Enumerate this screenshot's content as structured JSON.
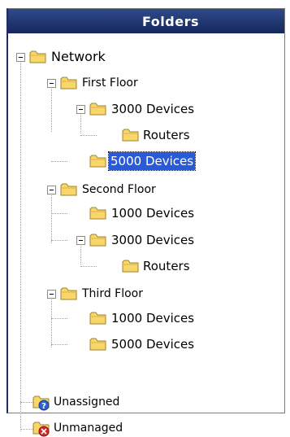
{
  "panel": {
    "title": "Folders"
  },
  "tree": {
    "root": "Network",
    "first_floor": "First Floor",
    "ff_3000": "3000 Devices",
    "ff_3000_routers": "Routers",
    "ff_5000": "5000 Devices",
    "second_floor": "Second Floor",
    "sf_1000": "1000 Devices",
    "sf_3000": "3000 Devices",
    "sf_3000_routers": "Routers",
    "third_floor": "Third Floor",
    "tf_1000": "1000 Devices",
    "tf_5000": "5000 Devices",
    "unassigned": "Unassigned",
    "unmanaged": "Unmanaged",
    "selected_item": "5000 Devices"
  },
  "icons": {
    "folder": "folder-icon",
    "unassigned": "folder-question-icon",
    "unmanaged": "folder-error-icon",
    "toggle": "collapse-minus-icon"
  },
  "colors": {
    "header": "#1c2d63",
    "selection": "#2a5bd7",
    "folder": "#f7d76a"
  }
}
